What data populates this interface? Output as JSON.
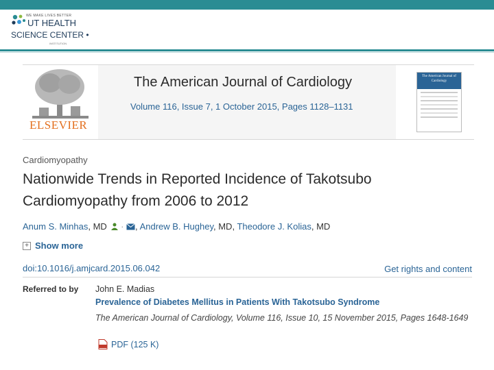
{
  "institution": {
    "tagline": "WE MAKE LIVES BETTER",
    "line1": "UT HEALTH",
    "line2": "SCIENCE CENTER",
    "sub": "INSTITUTION"
  },
  "journal": {
    "publisher": "ELSEVIER",
    "title": "The American Journal of Cardiology",
    "volume_line": "Volume 116, Issue 7, 1 October 2015, Pages 1128–1131",
    "cover_title": "The American Journal of Cardiology"
  },
  "article": {
    "section": "Cardiomyopathy",
    "title": "Nationwide Trends in Reported Incidence of Takotsubo Cardiomyopathy from 2006 to 2012",
    "authors": [
      {
        "name": "Anum S. Minhas",
        "suffix": ", MD"
      },
      {
        "name": "Andrew B. Hughey",
        "suffix": ", MD, "
      },
      {
        "name": "Theodore J. Kolias",
        "suffix": ", MD"
      }
    ],
    "show_more": "Show more",
    "doi": "doi:10.1016/j.amjcard.2015.06.042",
    "rights": "Get rights and content"
  },
  "referred": {
    "label": "Referred to by",
    "author": "John E. Madias",
    "title": "Prevalence of Diabetes Mellitus in Patients With Takotsubo Syndrome",
    "source": "The American Journal of Cardiology, Volume 116, Issue 10, 15 November 2015, Pages 1648-1649",
    "pdf_label": "PDF (125 K)"
  },
  "colors": {
    "accent_teal": "#2a8c93",
    "link_blue": "#2a6496",
    "elsevier_orange": "#e36f1e"
  }
}
